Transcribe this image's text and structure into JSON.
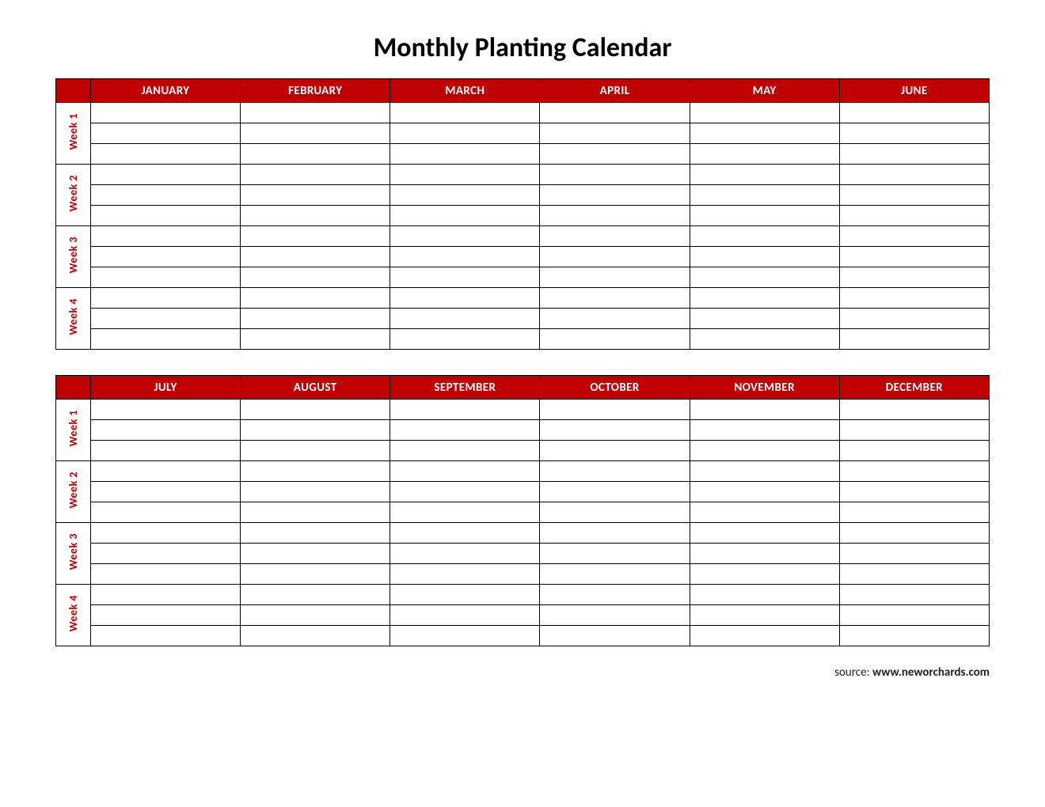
{
  "title": "Monthly Planting Calendar",
  "weeks": [
    "Week 1",
    "Week 2",
    "Week 3",
    "Week 4"
  ],
  "rows_per_week": 3,
  "tables": [
    {
      "months": [
        "JANUARY",
        "FEBRUARY",
        "MARCH",
        "APRIL",
        "MAY",
        "JUNE"
      ]
    },
    {
      "months": [
        "JULY",
        "AUGUST",
        "SEPTEMBER",
        "OCTOBER",
        "NOVEMBER",
        "DECEMBER"
      ]
    }
  ],
  "source": {
    "label": "source: ",
    "url": "www.neworchards.com"
  }
}
